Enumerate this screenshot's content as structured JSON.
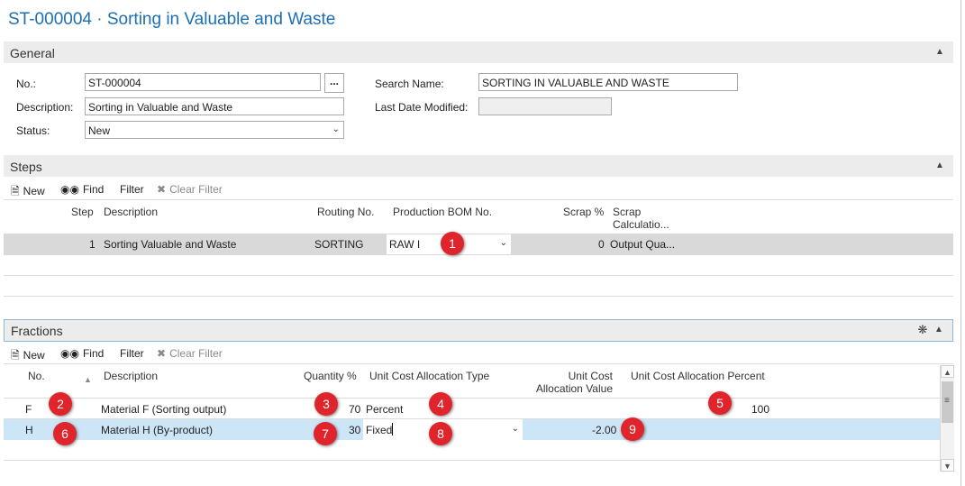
{
  "page_title": "ST-000004 · Sorting in Valuable and Waste",
  "general": {
    "section_label": "General",
    "no_label": "No.:",
    "no_value": "ST-000004",
    "assist_label": "...",
    "description_label": "Description:",
    "description_value": "Sorting in Valuable and Waste",
    "status_label": "Status:",
    "status_value": "New",
    "search_name_label": "Search Name:",
    "search_name_value": "SORTING IN VALUABLE AND WASTE",
    "last_modified_label": "Last Date Modified:",
    "last_modified_value": ""
  },
  "steps": {
    "section_label": "Steps",
    "toolbar": {
      "new": "New",
      "find": "Find",
      "filter": "Filter",
      "clear_filter": "Clear Filter"
    },
    "headers": {
      "step": "Step",
      "description": "Description",
      "routing_no": "Routing No.",
      "production_bom_no": "Production BOM No.",
      "scrap_pct": "Scrap %",
      "scrap_calc_1": "Scrap",
      "scrap_calc_2": "Calculatio..."
    },
    "rows": [
      {
        "step": "1",
        "description": "Sorting Valuable and Waste",
        "routing_no": "SORTING",
        "production_bom_no": "RAW I",
        "scrap_pct": "0",
        "scrap_calc": "Output Qua..."
      }
    ]
  },
  "fractions": {
    "section_label": "Fractions",
    "toolbar": {
      "new": "New",
      "find": "Find",
      "filter": "Filter",
      "clear_filter": "Clear Filter"
    },
    "headers": {
      "no": "No.",
      "description": "Description",
      "quantity_pct": "Quantity %",
      "unit_cost_alloc_type": "Unit Cost Allocation Type",
      "unit_cost_alloc_value_1": "Unit Cost",
      "unit_cost_alloc_value_2": "Allocation Value",
      "unit_cost_alloc_percent": "Unit Cost Allocation Percent"
    },
    "rows": [
      {
        "no": "F",
        "description": "Material F (Sorting output)",
        "quantity_pct": "70",
        "alloc_type": "Percent",
        "alloc_value": "",
        "alloc_percent": "100"
      },
      {
        "no": "H",
        "description": "Material H (By-product)",
        "quantity_pct": "30",
        "alloc_type": "Fixed",
        "alloc_value": "-2.00",
        "alloc_percent": ""
      }
    ]
  },
  "badges": [
    "1",
    "2",
    "3",
    "4",
    "5",
    "6",
    "7",
    "8",
    "9"
  ],
  "colors": {
    "title": "#1c6fb4",
    "section_bg": "#ececec",
    "selected_row_steps": "#d9d9d9",
    "selected_row_fractions": "#cde6f7",
    "badge": "#e0242c"
  },
  "icons": [
    "new-icon",
    "find-binoculars-icon",
    "clear-filter-icon",
    "chevron-up-icon",
    "chevron-down-icon",
    "personalize-gear-icon",
    "sort-asc-icon",
    "scroll-up-icon",
    "scroll-down-icon"
  ]
}
